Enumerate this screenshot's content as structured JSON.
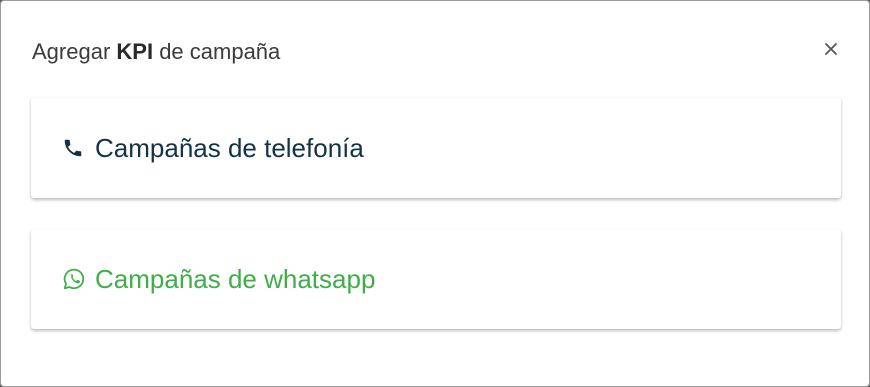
{
  "modal": {
    "title_prefix": "Agregar ",
    "title_bold": "KPI",
    "title_suffix": " de campaña",
    "close_glyph": "×"
  },
  "options": [
    {
      "label": "Campañas de telefonía",
      "icon": "phone-icon",
      "color": "#123247"
    },
    {
      "label": "Campañas de whatsapp",
      "icon": "whatsapp-icon",
      "color": "#3fae49"
    }
  ]
}
